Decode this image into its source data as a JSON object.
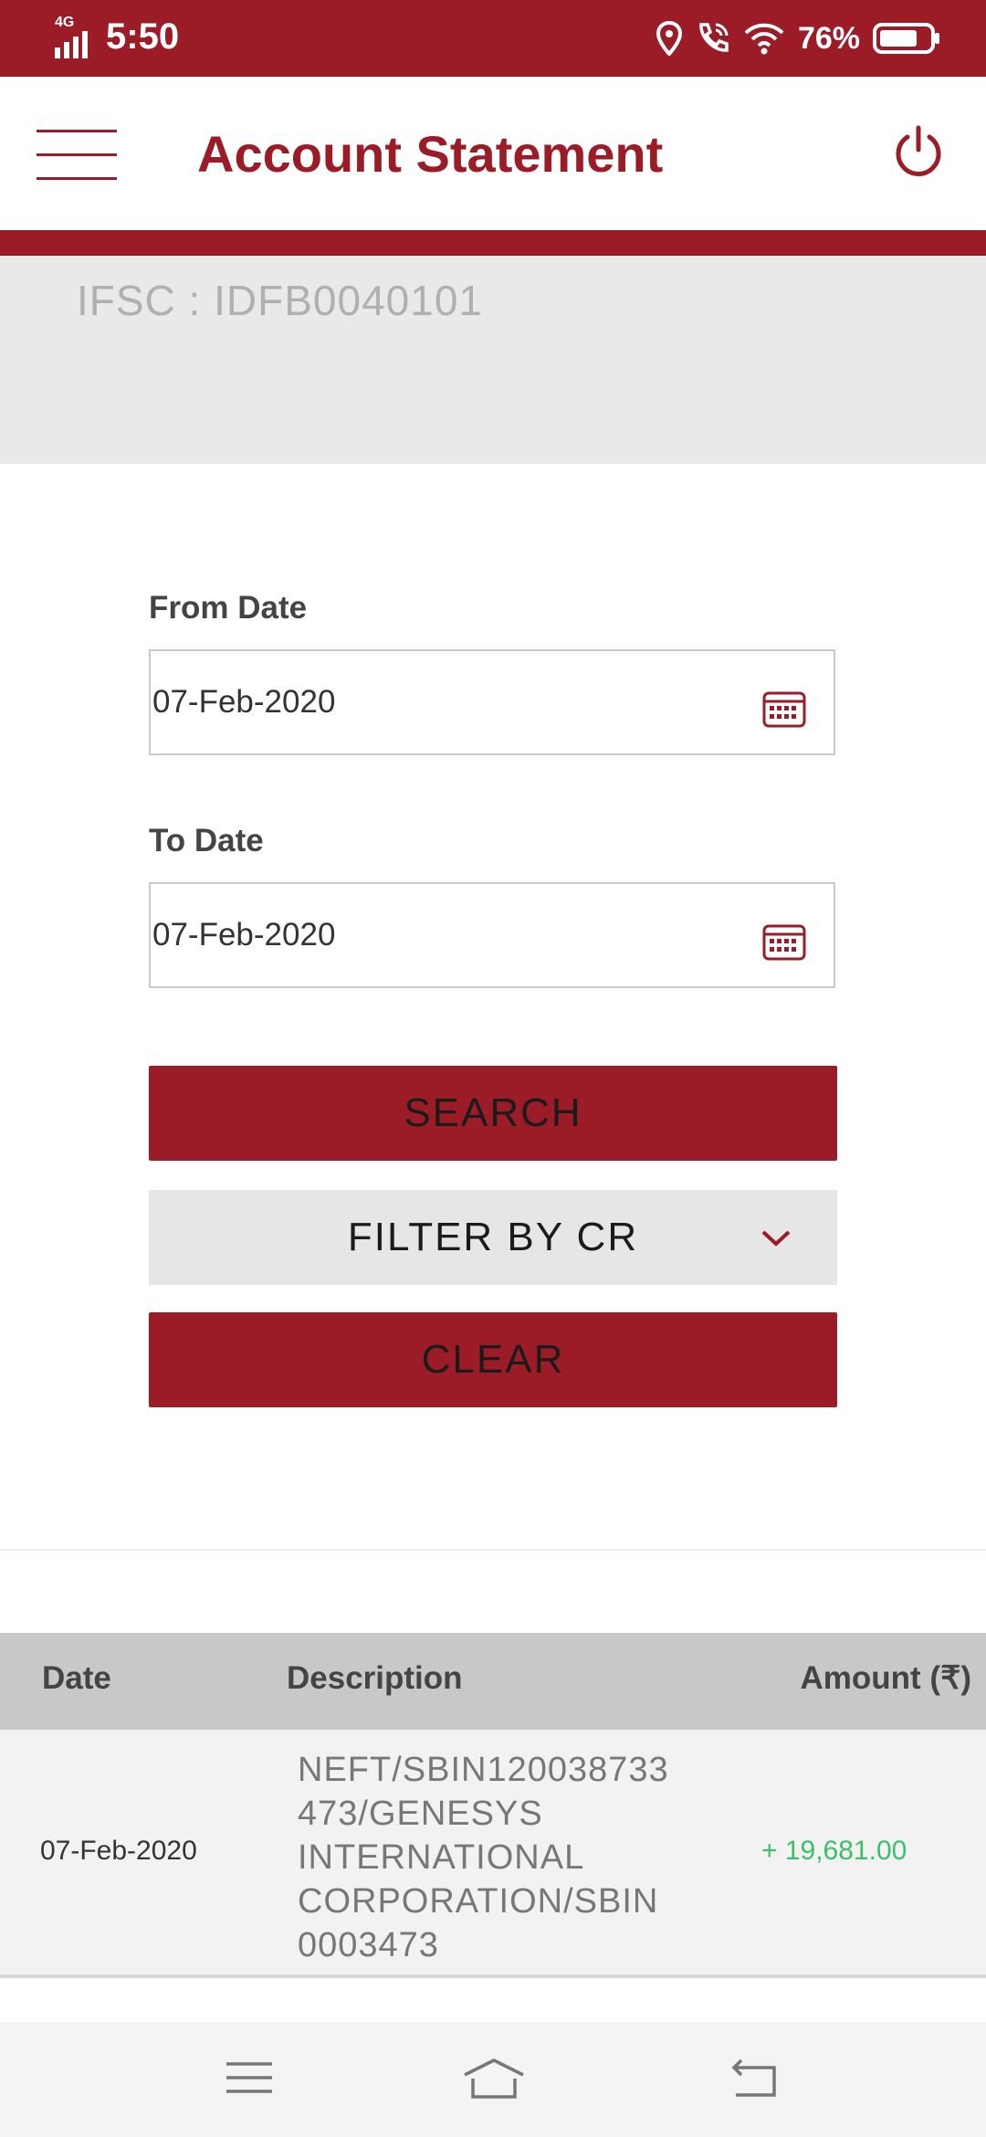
{
  "status_bar": {
    "network": "4G",
    "time": "5:50",
    "battery": "76%"
  },
  "app_bar": {
    "title": "Account Statement",
    "menu_icon": "hamburger-menu-icon",
    "power_icon": "power-icon"
  },
  "account": {
    "ifsc_line": "IFSC : IDFB0040101"
  },
  "form": {
    "from_label": "From Date",
    "from_value": "07-Feb-2020",
    "to_label": "To Date",
    "to_value": "07-Feb-2020",
    "search_label": "SEARCH",
    "filter_label": "FILTER BY CR",
    "clear_label": "CLEAR"
  },
  "table": {
    "headers": {
      "date": "Date",
      "description": "Description",
      "amount": "Amount (₹)"
    },
    "rows": [
      {
        "date": "07-Feb-2020",
        "description_lines": [
          "NEFT/SBIN120038733",
          "473/GENESYS",
          "INTERNATIONAL",
          "CORPORATION/SBIN",
          "0003473"
        ],
        "amount": "+ 19,681.00"
      }
    ]
  },
  "colors": {
    "brand": "#9b1c27",
    "credit": "#3cbf6b",
    "panel": "#e9e9e9"
  }
}
